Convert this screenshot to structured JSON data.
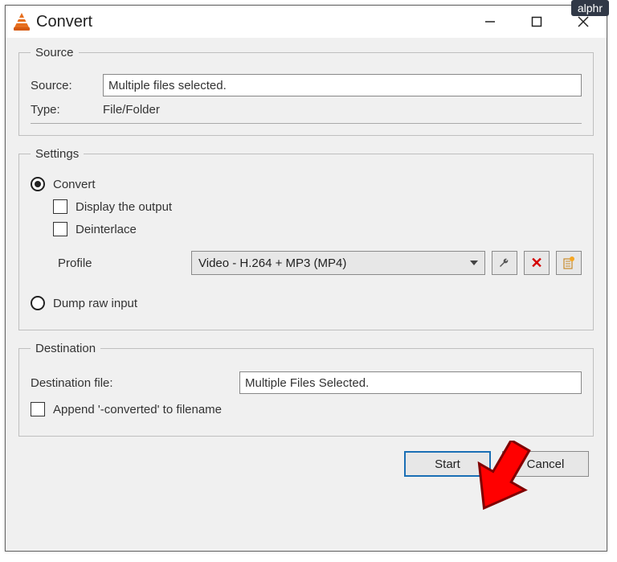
{
  "badge": "alphr",
  "window": {
    "title": "Convert"
  },
  "source": {
    "legend": "Source",
    "source_label": "Source:",
    "source_value": "Multiple files selected.",
    "type_label": "Type:",
    "type_value": "File/Folder"
  },
  "settings": {
    "legend": "Settings",
    "convert_label": "Convert",
    "display_output_label": "Display the output",
    "deinterlace_label": "Deinterlace",
    "profile_label": "Profile",
    "profile_value": "Video - H.264 + MP3 (MP4)",
    "dump_raw_label": "Dump raw input"
  },
  "destination": {
    "legend": "Destination",
    "file_label": "Destination file:",
    "file_value": "Multiple Files Selected.",
    "append_label": "Append '-converted' to filename"
  },
  "footer": {
    "start": "Start",
    "cancel": "Cancel"
  }
}
